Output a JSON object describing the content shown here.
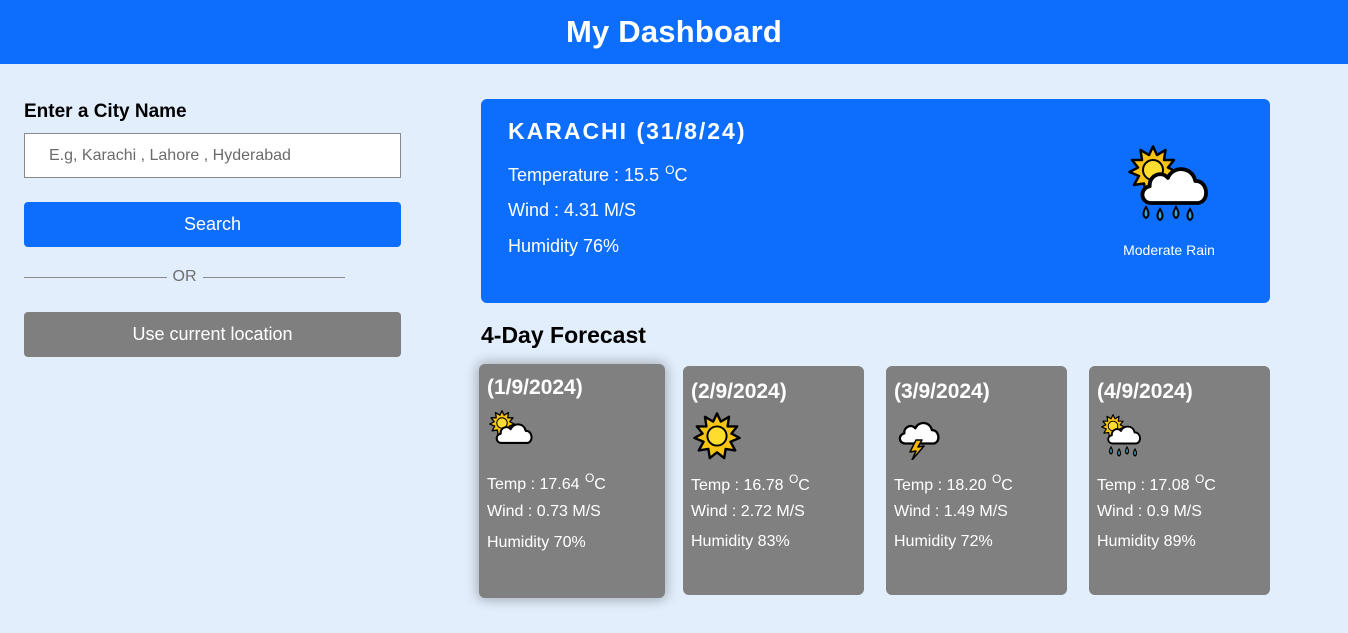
{
  "header": {
    "title": "My Dashboard"
  },
  "search": {
    "label": "Enter a City Name",
    "placeholder": "E.g, Karachi , Lahore , Hyderabad",
    "button_label": "Search",
    "divider_text": "OR",
    "location_button_label": "Use current location"
  },
  "current": {
    "city_date": "KARACHI (31/8/24)",
    "temperature_label": "Temperature : 15.5 ",
    "temperature_unit": "C",
    "degree_symbol": "O",
    "wind": "Wind : 4.31 M/S",
    "humidity": "Humidity 76%",
    "icon": "sun-cloud-rain-icon",
    "description": "Moderate Rain"
  },
  "forecast": {
    "title": "4-Day Forecast",
    "days": [
      {
        "date": "(1/9/2024)",
        "icon": "sun-behind-cloud-icon",
        "temp": "Temp : 17.64 ",
        "unit": "C",
        "wind": "Wind : 0.73 M/S",
        "humidity": "Humidity 70%"
      },
      {
        "date": "(2/9/2024)",
        "icon": "sun-icon",
        "temp": "Temp : 16.78 ",
        "unit": "C",
        "wind": "Wind : 2.72 M/S",
        "humidity": "Humidity 83%"
      },
      {
        "date": "(3/9/2024)",
        "icon": "thunder-cloud-icon",
        "temp": "Temp : 18.20 ",
        "unit": "C",
        "wind": "Wind : 1.49 M/S",
        "humidity": "Humidity 72%"
      },
      {
        "date": "(4/9/2024)",
        "icon": "sun-cloud-rain-icon",
        "temp": "Temp : 17.08 ",
        "unit": "C",
        "wind": "Wind : 0.9 M/S",
        "humidity": "Humidity 89%"
      }
    ]
  },
  "colors": {
    "primary": "#0d6efd",
    "background": "#e3eefc",
    "card_gray": "#808080"
  }
}
